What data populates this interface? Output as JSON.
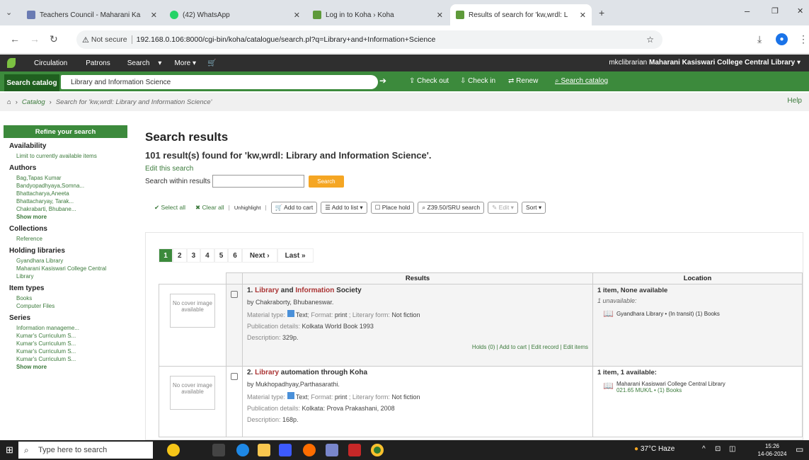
{
  "browser": {
    "tabs": [
      {
        "label": "Teachers Council - Maharani Ka"
      },
      {
        "label": "(42) WhatsApp"
      },
      {
        "label": "Log in to Koha › Koha"
      },
      {
        "label": "Results of search for 'kw,wrdl: L"
      }
    ],
    "not_secure": "Not secure",
    "url": "192.168.0.106:8000/cgi-bin/koha/catalogue/search.pl?q=Library+and+Information+Science"
  },
  "topnav": {
    "items": [
      "Circulation",
      "Patrons",
      "Search",
      "More"
    ],
    "user": "mkclibrarian",
    "library": "Maharani Kasiswari College Central Library"
  },
  "searchbar": {
    "tab": "Search catalog",
    "query": "Library and Information Science",
    "checkout": "Check out",
    "checkin": "Check in",
    "renew": "Renew",
    "search_catalog": "Search catalog"
  },
  "breadcrumb": {
    "catalog": "Catalog",
    "current": "Search for 'kw,wrdl: Library and Information Science'",
    "help": "Help"
  },
  "sidebar": {
    "refine": "Refine your search",
    "availability": "Availability",
    "availability_item": "Limit to currently available items",
    "authors": "Authors",
    "author_items": [
      "Bag,Tapas Kumar",
      "Bandyopadhyaya,Somna...",
      "Bhattacharya,Aneeta",
      "Bhattacharyay, Tarak...",
      "Chakrabarti, Bhubane..."
    ],
    "show_more": "Show more",
    "collections": "Collections",
    "collection_items": [
      "Reference"
    ],
    "holding": "Holding libraries",
    "holding_items": [
      "Gyandhara Library",
      "Maharani Kasiswari College Central Library"
    ],
    "item_types": "Item types",
    "item_type_items": [
      "Books",
      "Computer Files"
    ],
    "series": "Series",
    "series_items": [
      "Information manageme...",
      "Kumar's Curriculum S...",
      "Kumar's Curriculum S...",
      "Kumar's Curriculum S...",
      "Kumar's Curriculum S..."
    ],
    "series_more": "Show more"
  },
  "main": {
    "title": "Search results",
    "found": "101 result(s) found for 'kw,wrdl: Library and Information Science'.",
    "edit_search": "Edit this search",
    "within_label": "Search within results",
    "search_btn": "Search",
    "toolbar": {
      "select_all": "Select all",
      "clear_all": "Clear all",
      "unhighlight": "Unhighlight",
      "add_cart": "Add to cart",
      "add_list": "Add to list",
      "place_hold": "Place hold",
      "z3950": "Z39.50/SRU search",
      "edit": "Edit",
      "sort": "Sort"
    },
    "pages": [
      "1",
      "2",
      "3",
      "4",
      "5",
      "6"
    ],
    "next": "Next ›",
    "last": "Last »",
    "col_results": "Results",
    "col_location": "Location",
    "no_cover": "No cover image available",
    "results": [
      {
        "num": "1.",
        "title_a": "Library",
        "title_b": " and ",
        "title_c": "Information",
        "title_d": " Society",
        "author": "by Chakraborty, Bhubaneswar.",
        "material": "Text",
        "format": "print",
        "literary": "Not fiction",
        "pub": "Kolkata World Book 1993",
        "desc": "329p.",
        "actions": "Holds (0) | Add to cart | Edit record | Edit items",
        "loc_summary": "1 item, None available",
        "loc_status": "1 unavailable:",
        "loc_detail": "Gyandhara Library • (In transit) (1) Books"
      },
      {
        "num": "2.",
        "title_a": "Library",
        "title_b": " automation through Koha",
        "author": "by Mukhopadhyay,Parthasarathi.",
        "material": "Text",
        "format": "print",
        "literary": "Not fiction",
        "pub": "Kolkata: Prova Prakashani, 2008",
        "desc": "168p.",
        "loc_summary": "1 item, 1 available:",
        "loc_detail1": "Maharani Kasiswari College Central Library",
        "loc_detail2": "021.65 MUK/L • (1) Books"
      }
    ]
  },
  "taskbar": {
    "search_placeholder": "Type here to search",
    "weather": "37°C Haze",
    "time": "15:26",
    "date": "14-06-2024"
  }
}
